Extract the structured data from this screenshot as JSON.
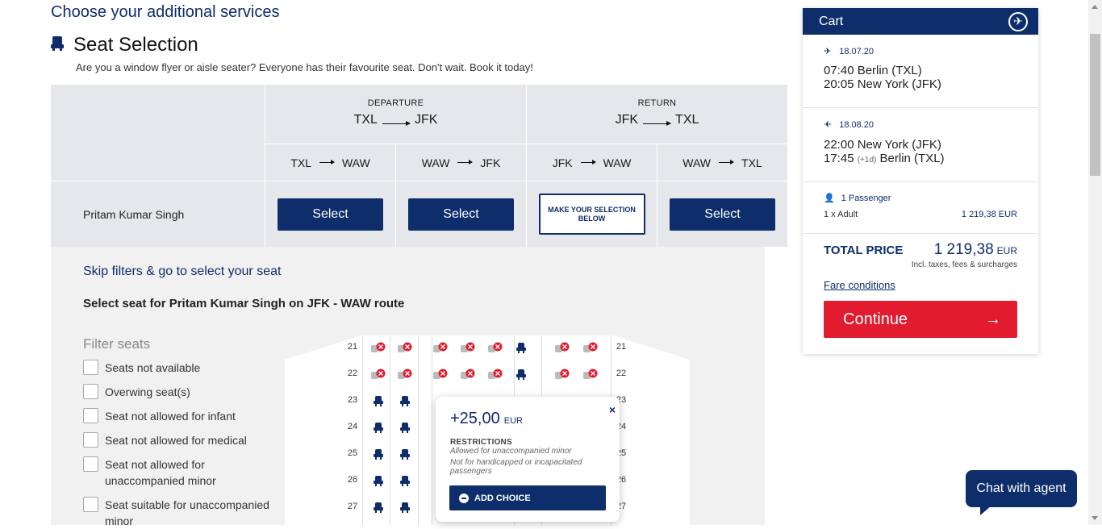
{
  "heading": "Choose your additional services",
  "seat_section": {
    "title": "Seat Selection",
    "subtitle": "Are you a window flyer or aisle seater? Everyone has their favourite seat. Don't wait. Book it today!"
  },
  "grid": {
    "departure": {
      "caption": "DEPARTURE",
      "from": "TXL",
      "to": "JFK"
    },
    "return": {
      "caption": "RETURN",
      "from": "JFK",
      "to": "TXL"
    },
    "legs": [
      {
        "from": "TXL",
        "to": "WAW"
      },
      {
        "from": "WAW",
        "to": "JFK"
      },
      {
        "from": "JFK",
        "to": "WAW"
      },
      {
        "from": "WAW",
        "to": "TXL"
      }
    ],
    "passenger_name": "Pritam Kumar Singh",
    "select_label": "Select",
    "make_selection_label": "MAKE YOUR SELECTION BELOW"
  },
  "lower": {
    "skip_link": "Skip filters & go to select your seat",
    "select_for": "Select seat for Pritam Kumar Singh on JFK - WAW route",
    "filter_title": "Filter seats",
    "filters": [
      "Seats not available",
      "Overwing seat(s)",
      "Seat not allowed for infant",
      "Seat not allowed for medical",
      "Seat not allowed for unaccompanied minor",
      "Seat suitable for unaccompanied minor"
    ],
    "rows": [
      "21",
      "22",
      "23",
      "24",
      "25",
      "26",
      "27"
    ],
    "row_suffix_visible": [
      "21",
      "22",
      "23",
      "24",
      "25",
      "26",
      "27"
    ]
  },
  "popup": {
    "price": "+25,00",
    "currency": "EUR",
    "restrictions_title": "RESTRICTIONS",
    "restriction_1": "Allowed for unaccompanied minor",
    "restriction_2": "Not for handicapped or incapacitated passengers",
    "add_label": "ADD CHOICE",
    "close": "×"
  },
  "cart": {
    "title": "Cart",
    "outbound": {
      "date": "18.07.20",
      "dep": "07:40 Berlin (TXL)",
      "arr": "20:05 New York (JFK)"
    },
    "inbound": {
      "date": "18.08.20",
      "dep": "22:00 New York (JFK)",
      "arr_time": "17:45",
      "arr_plus": "(+1d)",
      "arr_city": "Berlin (TXL)"
    },
    "passengers": "1 Passenger",
    "pax_type": "1 x Adult",
    "pax_price": "1 219,38 EUR",
    "total_label": "TOTAL PRICE",
    "total_amount": "1 219,38",
    "total_currency": "EUR",
    "incl": "Incl. taxes, fees & surcharges",
    "fare_conditions": "Fare conditions",
    "continue": "Continue"
  },
  "chat": "Chat with agent",
  "colors": {
    "brand": "#0e2d6b",
    "accent": "#e21b2e"
  }
}
